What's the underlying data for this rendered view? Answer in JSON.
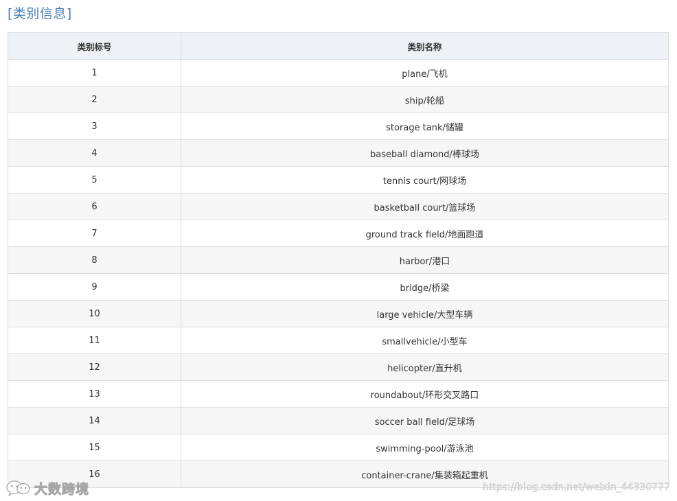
{
  "section": {
    "title": "[类别信息]"
  },
  "table": {
    "headers": [
      "类别标号",
      "类别名称"
    ],
    "rows": [
      {
        "id": "1",
        "name": "plane/飞机"
      },
      {
        "id": "2",
        "name": "ship/轮船"
      },
      {
        "id": "3",
        "name": "storage tank/储罐"
      },
      {
        "id": "4",
        "name": "baseball diamond/棒球场"
      },
      {
        "id": "5",
        "name": "tennis court/网球场"
      },
      {
        "id": "6",
        "name": "basketball court/篮球场"
      },
      {
        "id": "7",
        "name": "ground track field/地面跑道"
      },
      {
        "id": "8",
        "name": "harbor/港口"
      },
      {
        "id": "9",
        "name": "bridge/桥梁"
      },
      {
        "id": "10",
        "name": "large vehicle/大型车辆"
      },
      {
        "id": "11",
        "name": "smallvehicle/小型车"
      },
      {
        "id": "12",
        "name": "helicopter/直升机"
      },
      {
        "id": "13",
        "name": "roundabout/环形交叉路口"
      },
      {
        "id": "14",
        "name": "soccer ball field/足球场"
      },
      {
        "id": "15",
        "name": "swimming-pool/游泳池"
      },
      {
        "id": "16",
        "name": "container-crane/集装箱起重机"
      }
    ]
  },
  "watermark": {
    "left_text": "大数跨境",
    "left_icon": "wechat-icon",
    "right_text": "https://blog.csdn.net/weixin_44330777"
  }
}
